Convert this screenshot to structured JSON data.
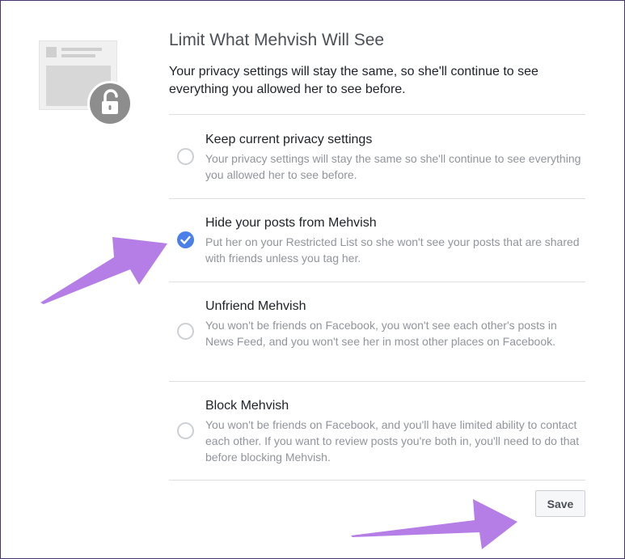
{
  "dialog": {
    "title": "Limit What Mehvish Will See",
    "intro": "Your privacy settings will stay the same, so she'll continue to see everything you allowed her to see before."
  },
  "options": [
    {
      "title": "Keep current privacy settings",
      "description": "Your privacy settings will stay the same so she'll continue to see everything you allowed her to see before.",
      "selected": false
    },
    {
      "title": "Hide your posts from Mehvish",
      "description": "Put her on your Restricted List so she won't see your posts that are shared with friends unless you tag her.",
      "selected": true
    },
    {
      "title": "Unfriend Mehvish",
      "description": "You won't be friends on Facebook, you won't see each other's posts in News Feed, and you won't see her in most other places on Facebook.",
      "selected": false
    },
    {
      "title": "Block Mehvish",
      "description": "You won't be friends on Facebook, and you'll have limited ability to contact each other. If you want to review posts you're both in, you'll need to do that before blocking Mehvish.",
      "selected": false
    }
  ],
  "actions": {
    "save_label": "Save"
  },
  "icons": {
    "illustration": "locked-document-icon",
    "lock": "unlocked-padlock-icon",
    "check": "check-icon",
    "annotation": "annotation-arrow-icon"
  },
  "colors": {
    "accent": "#4a80e8",
    "annotation_arrow": "#b57ee6",
    "text_primary": "#1d2129",
    "text_secondary": "#90949c",
    "divider": "#dddfe2"
  }
}
